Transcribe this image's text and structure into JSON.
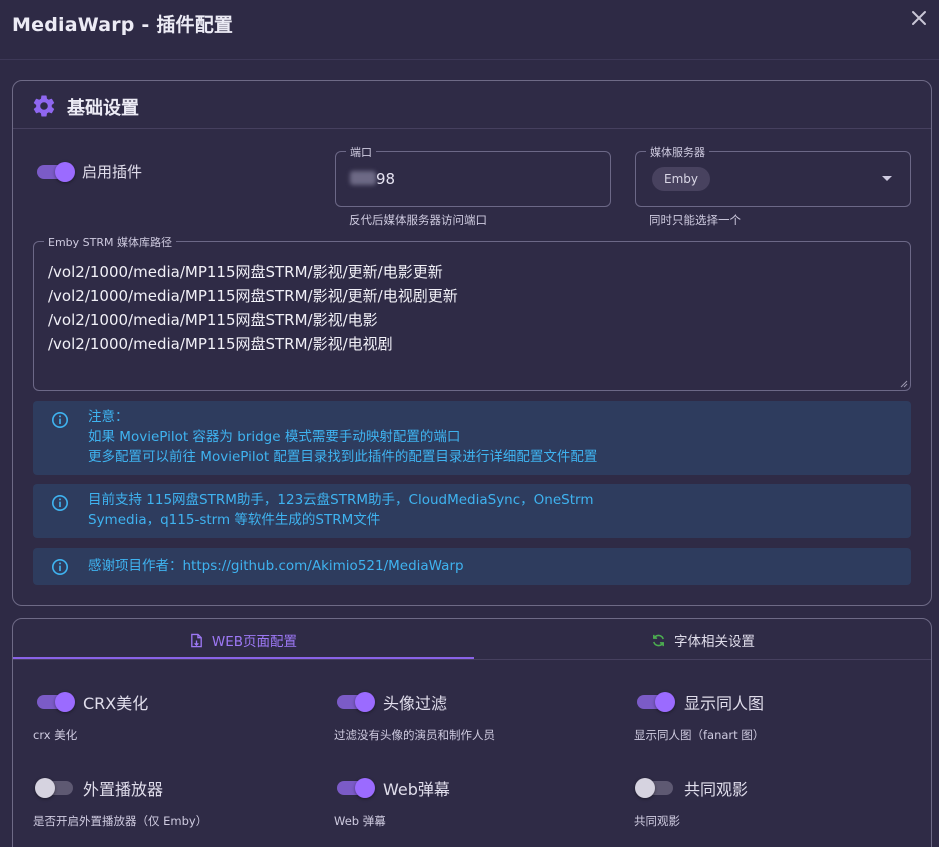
{
  "window": {
    "title": "MediaWarp - 插件配置"
  },
  "basic": {
    "heading": "基础设置",
    "enable": {
      "label": "启用插件",
      "on": true
    },
    "port": {
      "legend": "端口",
      "value": "98",
      "hint": "反代后媒体服务器访问端口"
    },
    "media_server": {
      "legend": "媒体服务器",
      "chip": "Emby",
      "hint": "同时只能选择一个"
    },
    "strm_paths": {
      "legend": "Emby STRM 媒体库路径",
      "lines": [
        "/vol2/1000/media/MP115网盘STRM/影视/更新/电影更新",
        "/vol2/1000/media/MP115网盘STRM/影视/更新/电视剧更新",
        "/vol2/1000/media/MP115网盘STRM/影视/电影",
        "/vol2/1000/media/MP115网盘STRM/影视/电视剧"
      ]
    },
    "alerts": [
      {
        "lines": [
          "注意：",
          "如果 MoviePilot 容器为 bridge 模式需要手动映射配置的端口",
          "更多配置可以前往 MoviePilot 配置目录找到此插件的配置目录进行详细配置文件配置"
        ]
      },
      {
        "lines": [
          "目前支持 115网盘STRM助手，123云盘STRM助手，CloudMediaSync，OneStrm",
          "Symedia，q115-strm 等软件生成的STRM文件"
        ]
      },
      {
        "lines": [
          "感谢项目作者：https://github.com/Akimio521/MediaWarp"
        ]
      }
    ]
  },
  "tabs": [
    {
      "label": "WEB页面配置",
      "icon": "file-icon",
      "active": true
    },
    {
      "label": "字体相关设置",
      "icon": "refresh-icon",
      "active": false
    }
  ],
  "web_options": [
    {
      "label": "CRX美化",
      "sub": "crx 美化",
      "on": true
    },
    {
      "label": "头像过滤",
      "sub": "过滤没有头像的演员和制作人员",
      "on": true
    },
    {
      "label": "显示同人图",
      "sub": "显示同人图（fanart 图）",
      "on": true
    },
    {
      "label": "外置播放器",
      "sub": "是否开启外置播放器（仅 Emby）",
      "on": false
    },
    {
      "label": "Web弹幕",
      "sub": "Web 弹幕",
      "on": true
    },
    {
      "label": "共同观影",
      "sub": "共同观影",
      "on": false
    }
  ],
  "colors": {
    "accent": "#9b6bff",
    "info": "#3fb3f0",
    "background": "#2e2a45"
  }
}
